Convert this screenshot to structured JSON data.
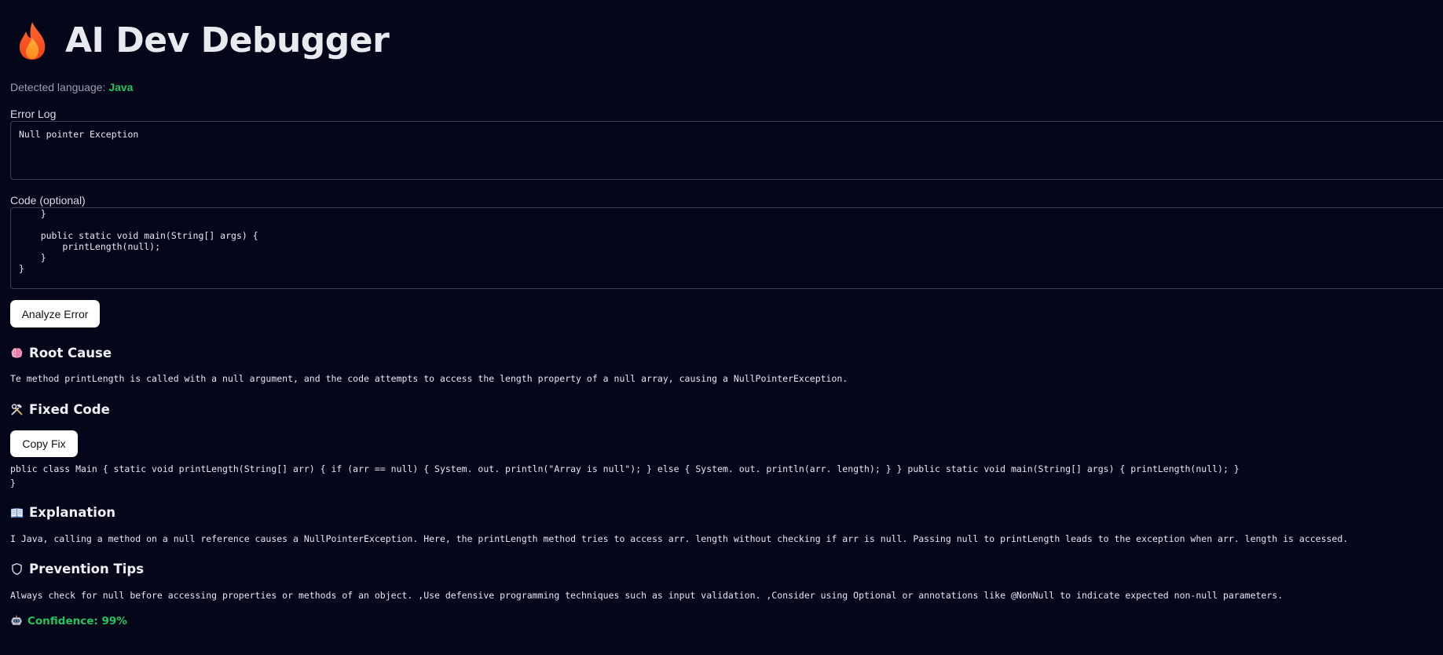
{
  "app": {
    "title": "AI Dev Debugger"
  },
  "detected": {
    "prefix": "Detected language:",
    "language": "Java"
  },
  "error_log": {
    "label": "Error Log",
    "value": "Null pointer Exception"
  },
  "code": {
    "label": "Code (optional)",
    "value": "    }\n\n    public static void main(String[] args) {\n        printLength(null);\n    }\n}"
  },
  "analyze_button": "Analyze Error",
  "root_cause": {
    "heading": "Root Cause",
    "text": "Te method printLength is called with a null argument, and the code attempts to access the length property of a null array, causing a NullPointerException."
  },
  "fixed_code": {
    "heading": "Fixed Code",
    "copy_button": "Copy Fix",
    "line1": "pblic class Main { static void printLength(String[] arr) { if (arr == null) { System. out. println(\"Array is null\"); } else { System. out. println(arr. length); } } public static void main(String[] args) { printLength(null); }",
    "line2": "}"
  },
  "explanation": {
    "heading": "Explanation",
    "text": "I Java, calling a method on a null reference causes a NullPointerException. Here, the printLength method tries to access arr. length without checking if arr is null. Passing null to printLength leads to the exception when arr. length is accessed."
  },
  "prevention": {
    "heading": "Prevention Tips",
    "text": "Always check for null before accessing properties or methods of an object. ,Use defensive programming techniques such as input validation. ,Consider using Optional or annotations like @NonNull to indicate expected non-null parameters."
  },
  "confidence": {
    "text": "Confidence: 99%"
  },
  "icons": {
    "title": "flame-icon",
    "root_cause": "brain-icon",
    "fixed_code": "hammer-wrench-icon",
    "explanation": "open-book-icon",
    "prevention": "shield-icon",
    "confidence": "robot-icon"
  },
  "colors": {
    "background": "#04061a",
    "accent_green": "#22c55e",
    "border": "#3a3f52",
    "button_bg": "#ffffff"
  }
}
